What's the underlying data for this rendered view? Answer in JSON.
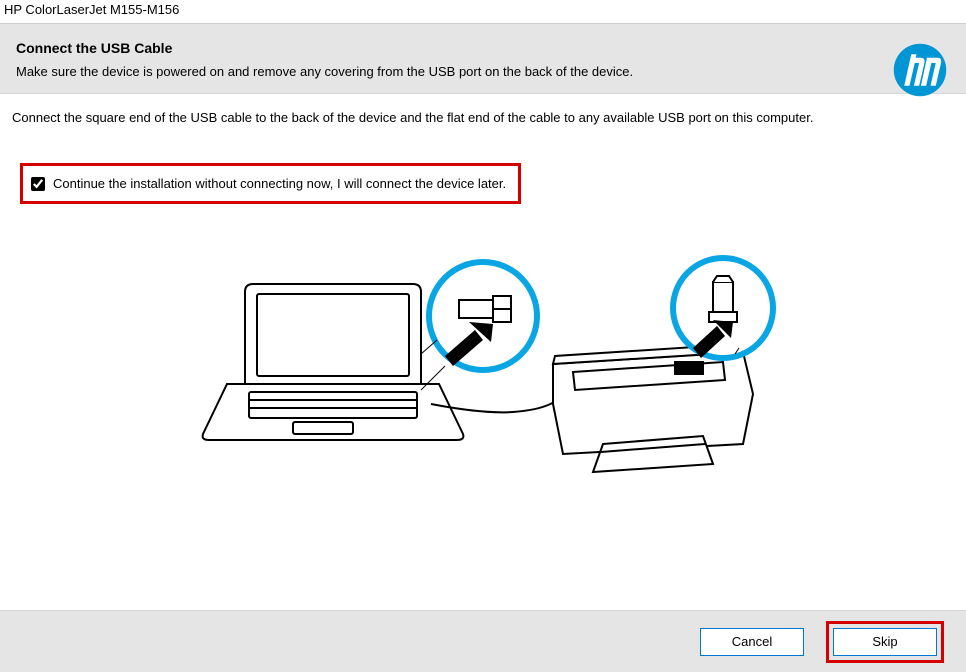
{
  "window": {
    "title": "HP ColorLaserJet M155-M156"
  },
  "header": {
    "title": "Connect the USB Cable",
    "subtitle": "Make sure the device is powered on and remove any covering from the USB port on the back of the device."
  },
  "content": {
    "instruction": "Connect the square end of the USB cable to the back of the device and the flat end of the cable to any available USB port on this computer.",
    "checkbox_label": "Continue the installation without connecting now, I will connect the device later.",
    "checkbox_checked": true
  },
  "footer": {
    "cancel_label": "Cancel",
    "skip_label": "Skip"
  },
  "colors": {
    "highlight": "#d40000",
    "hp_blue": "#0096d6",
    "button_border": "#0078d7"
  }
}
